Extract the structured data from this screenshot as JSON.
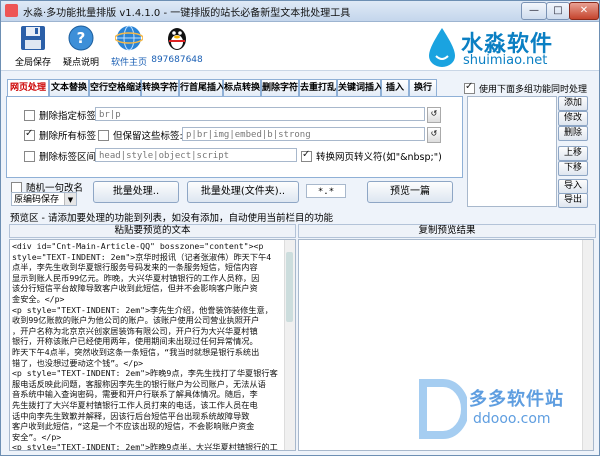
{
  "window": {
    "title": "水淼·多功能批量排版 v1.4.1.0 - 一键排版的站长必备新型文本批处理工具",
    "minimize": "—",
    "maximize": "□",
    "close": "✕"
  },
  "toolbar": {
    "save": "全局保存",
    "help": "疑点说明",
    "homepage": "软件主页",
    "qq": "897687648"
  },
  "logo": {
    "cn": "水淼软件",
    "en": "shuimiao.net"
  },
  "tabs": [
    "网页处理",
    "文本替换",
    "空行空格缩进",
    "转换字符",
    "行首尾插入",
    "标点转换",
    "删除字符",
    "去重打乱",
    "关键词插入",
    "插入",
    "换行"
  ],
  "options": {
    "remove_tags_label": "删除指定标签",
    "remove_tags_value": "br|p",
    "remove_all_label": "删除所有标签",
    "keep_tags_label": "但保留这些标签:",
    "keep_tags_value": "p|br|img|embed|b|strong",
    "remove_region_label": "删除标签区间",
    "remove_region_value": "head|style|object|script",
    "convert_space_label": "转换网页转义符(如\"&nbsp;\")"
  },
  "right": {
    "use_below_label": "使用下面多组功能同时处理",
    "add": "添加",
    "edit": "修改",
    "delete": "删除",
    "up": "上移",
    "down": "下移",
    "import": "导入",
    "export": "导出"
  },
  "actions": {
    "random_rename": "随机一句改名",
    "encoding": "原编码保存",
    "batch": "批量处理..",
    "batch_folder": "批量处理(文件夹)..",
    "pattern": "*.*",
    "preview": "预览一篇"
  },
  "preview_hint": "预览区 - 请添加要处理的功能到列表，如没有添加，自动使用当前栏目的功能",
  "left_header": "粘贴要预览的文本",
  "right_header": "复制预览结果",
  "source_text": "<div id=\"Cnt-Main-Article-QQ\" bosszone=\"content\"><p\nstyle=\"TEXT-INDENT: 2em\">京华时报讯（记者张淑伟）昨天下午4\n点半，李先生收到华夏银行服务号码发来的一条服务短信，短信内容\n显示到账人民币99亿元。昨晚，大兴华夏村镇银行的工作人员称，因\n该分行短信平台故障导致客户收到此短信，但并不会影响客户账户资\n金安全。</p>\n<p style=\"TEXT-INDENT: 2em\">李先生介绍，他誊装饰装修生意，\n收到99亿账款的账户为他公司的账户。该账户使用公司营业执照开户\n，开户名称为北京京兴创家居装饰有限公司，开户行为大兴华夏村镇\n银行，开称该账户已经使用两年，使用期间未出现过任何异常情况。\n昨天下午4点半，突然收到这条一条短信，“我当时就想是银行系统出\n错了，也没想过要动这个钱”。</p>\n<p style=\"TEXT-INDENT: 2em\">昨晚9点，李先生找打了华夏银行客\n服电话反映此问题，客服称因李先生的银行账户为公司账户，无法从语\n音系统中输入查询密码，需要和开户行联系了解具体情况。随后，李\n先生拨打了大兴华夏村镇银行工作人员打来的电话，该工作人员在电\n话中向李先生致歉并解释，因该行后台短信平台出现系统故障导致\n客户收到此短信，“这是一个不应该出现的短信，不会影响账户资金\n安全”。</p>\n<p style=\"TEXT-INDENT: 2em\">昨晚9点半，大兴华夏村镇银行的工\n作人员向记者介绍，因该分行后台短信平台出现故障，导致部分客户\n收到一条入账99亿元的短信。该工作人员称，因短信平台和其他系统平"
}
